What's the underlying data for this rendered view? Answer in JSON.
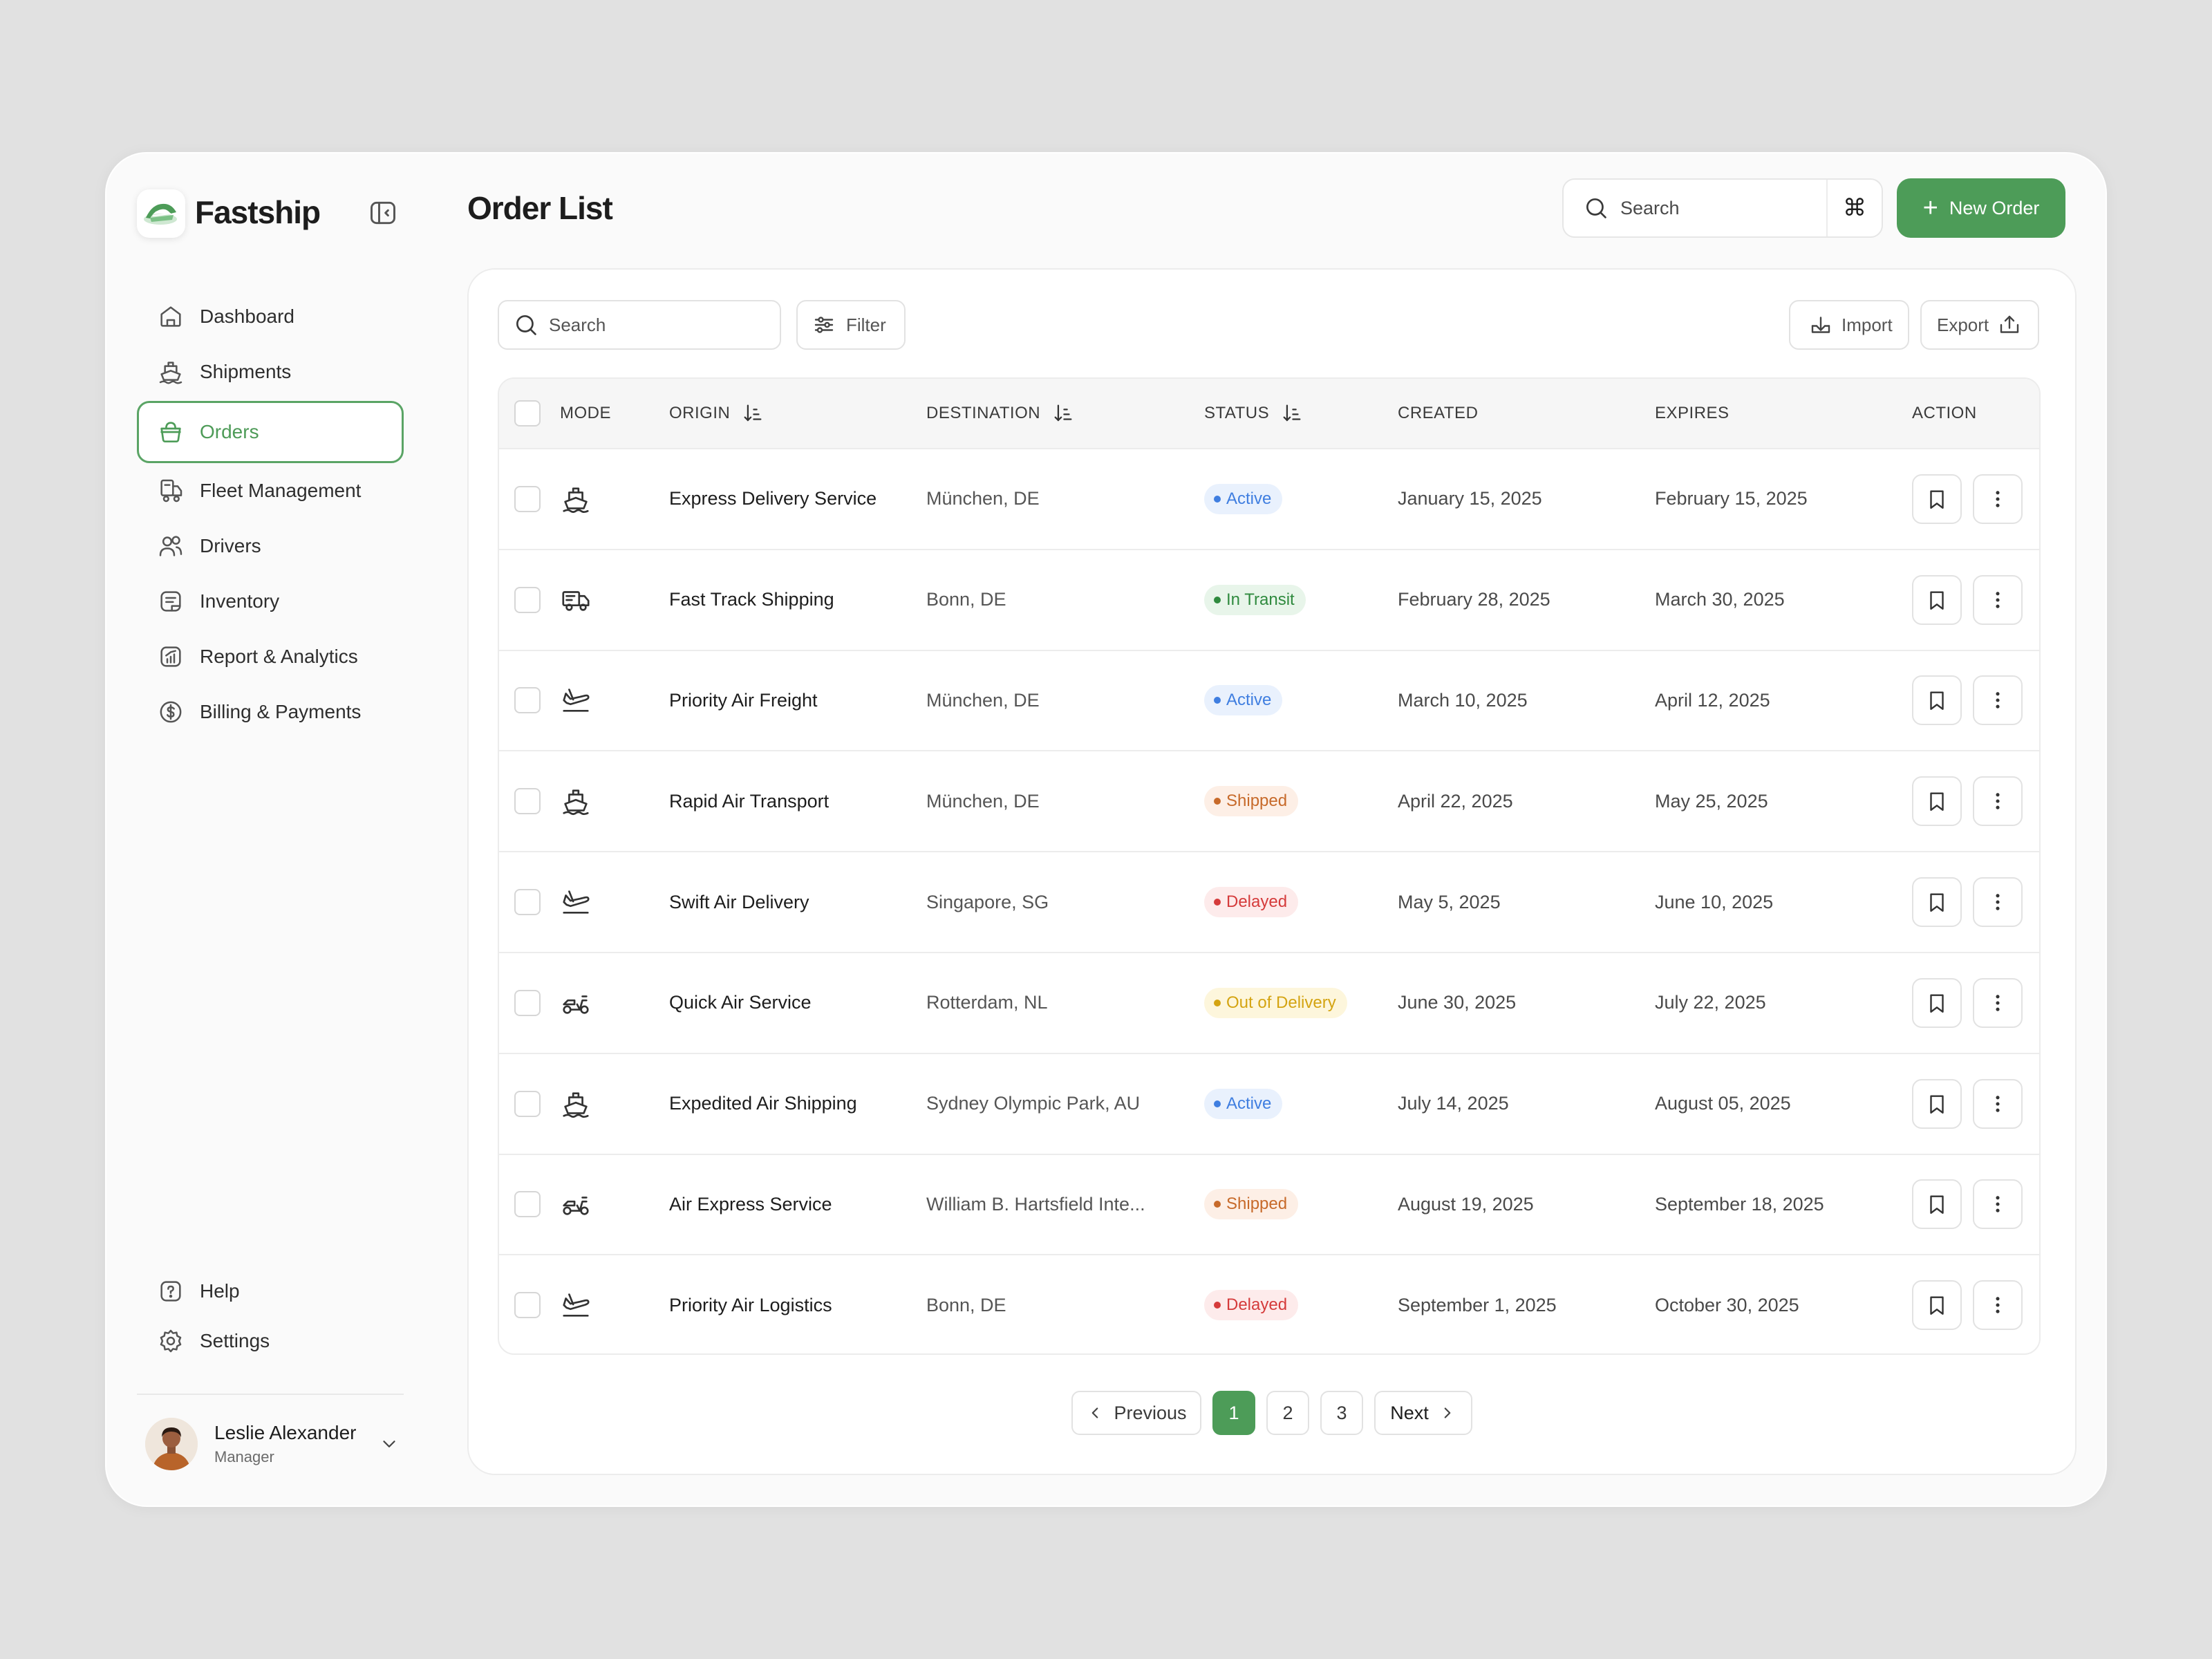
{
  "app": {
    "name": "Fastship",
    "brand_color": "#4d9c58"
  },
  "sidebar": {
    "items": [
      {
        "label": "Dashboard",
        "icon": "home-icon"
      },
      {
        "label": "Shipments",
        "icon": "ship-icon"
      },
      {
        "label": "Orders",
        "icon": "basket-icon",
        "active": true
      },
      {
        "label": "Fleet Management",
        "icon": "fleet-icon"
      },
      {
        "label": "Drivers",
        "icon": "users-icon"
      },
      {
        "label": "Inventory",
        "icon": "inventory-icon"
      },
      {
        "label": "Report & Analytics",
        "icon": "chart-icon"
      },
      {
        "label": "Billing & Payments",
        "icon": "dollar-icon"
      }
    ],
    "bottom": [
      {
        "label": "Help",
        "icon": "help-icon"
      },
      {
        "label": "Settings",
        "icon": "gear-icon"
      }
    ],
    "user": {
      "name": "Leslie Alexander",
      "role": "Manager"
    }
  },
  "header": {
    "title": "Order List",
    "search_placeholder": "Search",
    "shortcut": "⌘",
    "new_order_label": "New Order"
  },
  "toolbar": {
    "search_placeholder": "Search",
    "filter_label": "Filter",
    "import_label": "Import",
    "export_label": "Export"
  },
  "table": {
    "columns": {
      "mode": "MODE",
      "origin": "ORIGIN",
      "destination": "DESTINATION",
      "status": "STATUS",
      "created": "CREATED",
      "expires": "EXPIRES",
      "action": "ACTION"
    },
    "rows": [
      {
        "mode": "ship",
        "origin": "Express Delivery Service",
        "destination": "München, DE",
        "status": "Active",
        "created": "January 15, 2025",
        "expires": "February 15, 2025"
      },
      {
        "mode": "truck",
        "origin": "Fast Track Shipping",
        "destination": "Bonn, DE",
        "status": "In Transit",
        "created": "February 28, 2025",
        "expires": "March 30, 2025"
      },
      {
        "mode": "plane",
        "origin": "Priority Air Freight",
        "destination": "München, DE",
        "status": "Active",
        "created": "March 10, 2025",
        "expires": "April 12, 2025"
      },
      {
        "mode": "ship",
        "origin": "Rapid Air Transport",
        "destination": "München, DE",
        "status": "Shipped",
        "created": "April 22, 2025",
        "expires": "May 25, 2025"
      },
      {
        "mode": "plane",
        "origin": "Swift Air Delivery",
        "destination": "Singapore, SG",
        "status": "Delayed",
        "created": "May 5, 2025",
        "expires": "June 10, 2025"
      },
      {
        "mode": "scooter",
        "origin": "Quick Air Service",
        "destination": "Rotterdam, NL",
        "status": "Out of Delivery",
        "created": "June 30, 2025",
        "expires": "July 22, 2025"
      },
      {
        "mode": "ship",
        "origin": "Expedited Air Shipping",
        "destination": "Sydney Olympic Park, AU",
        "status": "Active",
        "created": "July 14, 2025",
        "expires": "August 05, 2025"
      },
      {
        "mode": "scooter",
        "origin": "Air Express Service",
        "destination": "William B. Hartsfield Inte...",
        "status": "Shipped",
        "created": "August 19, 2025",
        "expires": "September 18, 2025"
      },
      {
        "mode": "plane",
        "origin": "Priority Air Logistics",
        "destination": "Bonn, DE",
        "status": "Delayed",
        "created": "September 1, 2025",
        "expires": "October 30, 2025"
      }
    ]
  },
  "status_colors": {
    "Active": {
      "bg": "#e9f1fd",
      "fg": "#3f7ee0"
    },
    "In Transit": {
      "bg": "#e8f5ea",
      "fg": "#2f8a3e"
    },
    "Shipped": {
      "bg": "#fdefe6",
      "fg": "#c76a2a"
    },
    "Delayed": {
      "bg": "#fdebeb",
      "fg": "#d53b3b"
    },
    "Out of Delivery": {
      "bg": "#fdf6dc",
      "fg": "#d4a412"
    }
  },
  "pagination": {
    "previous": "Previous",
    "next": "Next",
    "pages": [
      "1",
      "2",
      "3"
    ],
    "current": "1"
  }
}
